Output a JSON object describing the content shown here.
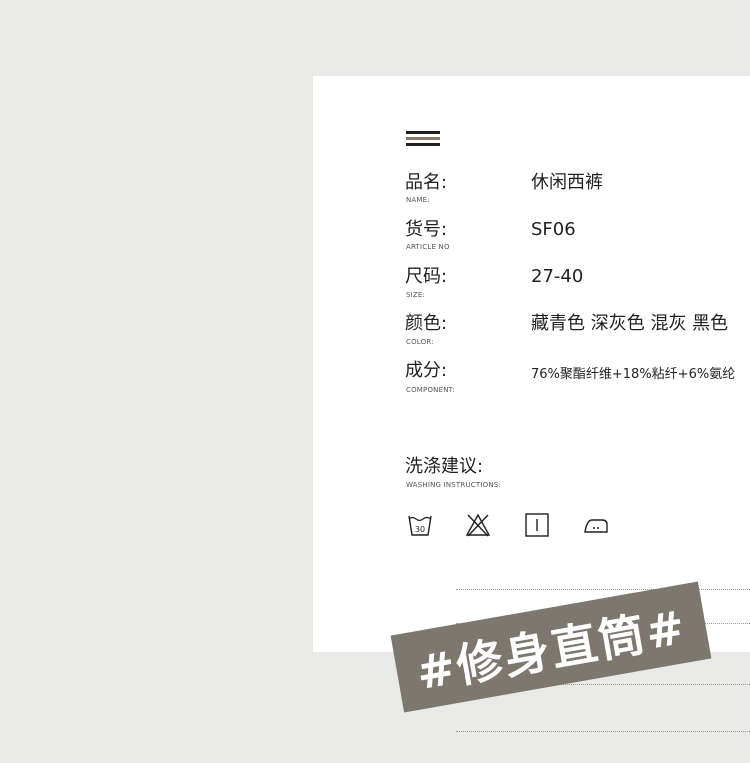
{
  "logo": {
    "icon": "stripes-logo-icon",
    "colors": [
      "#231f20",
      "#8a7b63",
      "#231f20"
    ]
  },
  "specs": [
    {
      "label": "品名:",
      "sub": "NAME:",
      "value": "休闲西裤"
    },
    {
      "label": "货号:",
      "sub": "ARTICLE NO",
      "value": "SF06"
    },
    {
      "label": "尺码:",
      "sub": "SIZE:",
      "value": "27-40"
    },
    {
      "label": "颜色:",
      "sub": "COLOR:",
      "value": "藏青色 深灰色 混灰 黑色"
    },
    {
      "label": "成分:",
      "sub": "COMPONENT:",
      "value": "76%聚酯纤维+18%粘纤+6%氨纶"
    }
  ],
  "washing": {
    "title": "洗涤建议:",
    "sub": "WASHING INSTRUCTIONS:",
    "icons": [
      {
        "name": "wash-30-icon",
        "text": "30"
      },
      {
        "name": "no-bleach-icon"
      },
      {
        "name": "tumble-dry-icon"
      },
      {
        "name": "iron-icon"
      }
    ]
  },
  "banner": {
    "text": "#修身直筒#",
    "color": "#7d786d"
  }
}
